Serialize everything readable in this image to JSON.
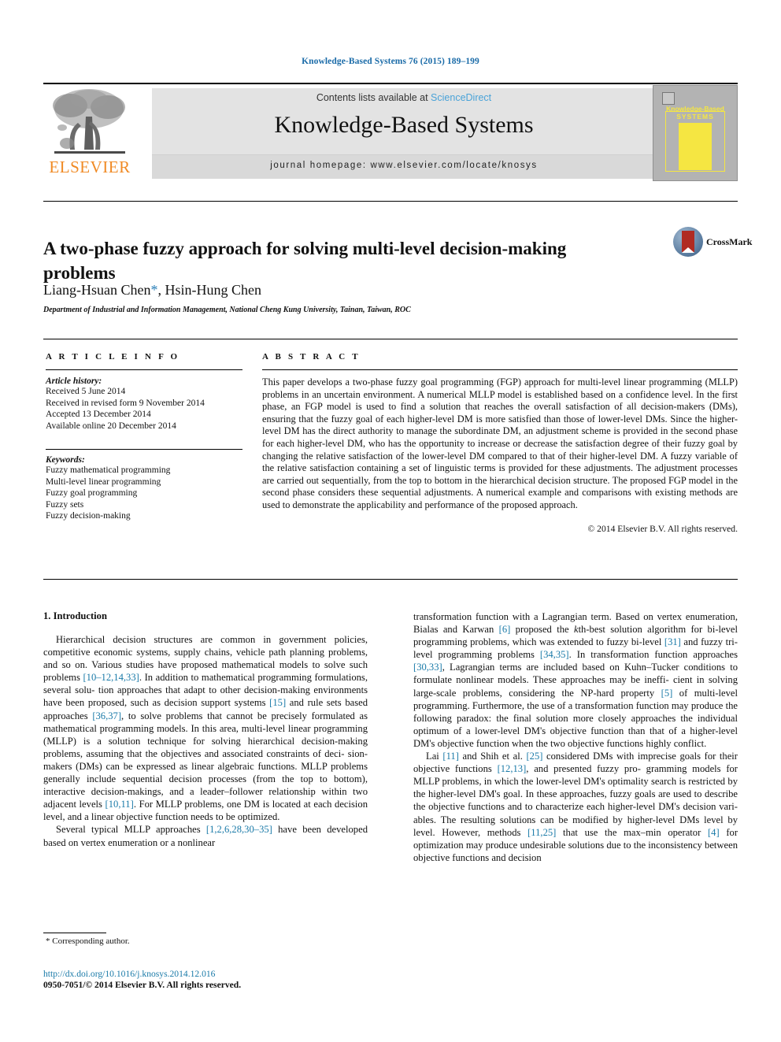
{
  "running_head": "Knowledge-Based Systems 76 (2015) 189–199",
  "masthead": {
    "publisher_logo_label": "ELSEVIER",
    "contents_prefix": "Contents lists available at ",
    "contents_link": "ScienceDirect",
    "journal_name": "Knowledge-Based Systems",
    "homepage": "journal homepage: www.elsevier.com/locate/knosys",
    "cover": {
      "line1": "Knowledge-Based",
      "line2": "SYSTEMS"
    }
  },
  "article": {
    "title": "A two-phase fuzzy approach for solving multi-level decision-making problems",
    "authors": "Liang-Hsuan Chen",
    "corresponding_marker": "*",
    "authors_rest": ", Hsin-Hung Chen",
    "affiliation": "Department of Industrial and Information Management, National Cheng Kung University, Tainan, Taiwan, ROC",
    "crossmark_label": "CrossMark"
  },
  "article_info": {
    "heading": "A R T I C L E   I N F O",
    "history_heading": "Article history:",
    "history": [
      "Received 5 June 2014",
      "Received in revised form 9 November 2014",
      "Accepted 13 December 2014",
      "Available online 20 December 2014"
    ],
    "keywords_heading": "Keywords:",
    "keywords": [
      "Fuzzy mathematical programming",
      "Multi-level linear programming",
      "Fuzzy goal programming",
      "Fuzzy sets",
      "Fuzzy decision-making"
    ]
  },
  "abstract": {
    "heading": "A B S T R A C T",
    "body": "This paper develops a two-phase fuzzy goal programming (FGP) approach for multi-level linear programming (MLLP) problems in an uncertain environment. A numerical MLLP model is established based on a confidence level. In the first phase, an FGP model is used to find a solution that reaches the overall satisfaction of all decision-makers (DMs), ensuring that the fuzzy goal of each higher-level DM is more satisfied than those of lower-level DMs. Since the higher-level DM has the direct authority to manage the subordinate DM, an adjustment scheme is provided in the second phase for each higher-level DM, who has the opportunity to increase or decrease the satisfaction degree of their fuzzy goal by changing the relative satisfaction of the lower-level DM compared to that of their higher-level DM. A fuzzy variable of the relative satisfaction containing a set of linguistic terms is provided for these adjustments. The adjustment processes are carried out sequentially, from the top to bottom in the hierarchical decision structure. The proposed FGP model in the second phase considers these sequential adjustments. A numerical example and comparisons with existing methods are used to demonstrate the applicability and performance of the proposed approach.",
    "copyright": "© 2014 Elsevier B.V. All rights reserved."
  },
  "section": {
    "heading": "1. Introduction"
  },
  "footnote": {
    "corresponding": "* Corresponding author."
  },
  "footer": {
    "doi": "http://dx.doi.org/10.1016/j.knosys.2014.12.016",
    "issn": "0950-7051/© 2014 Elsevier B.V. All rights reserved."
  },
  "colors": {
    "link": "#1a7aa8",
    "running_head": "#1a6ba8",
    "sciencedirect": "#4aa3d8",
    "elsevier_orange": "#f08a24"
  }
}
